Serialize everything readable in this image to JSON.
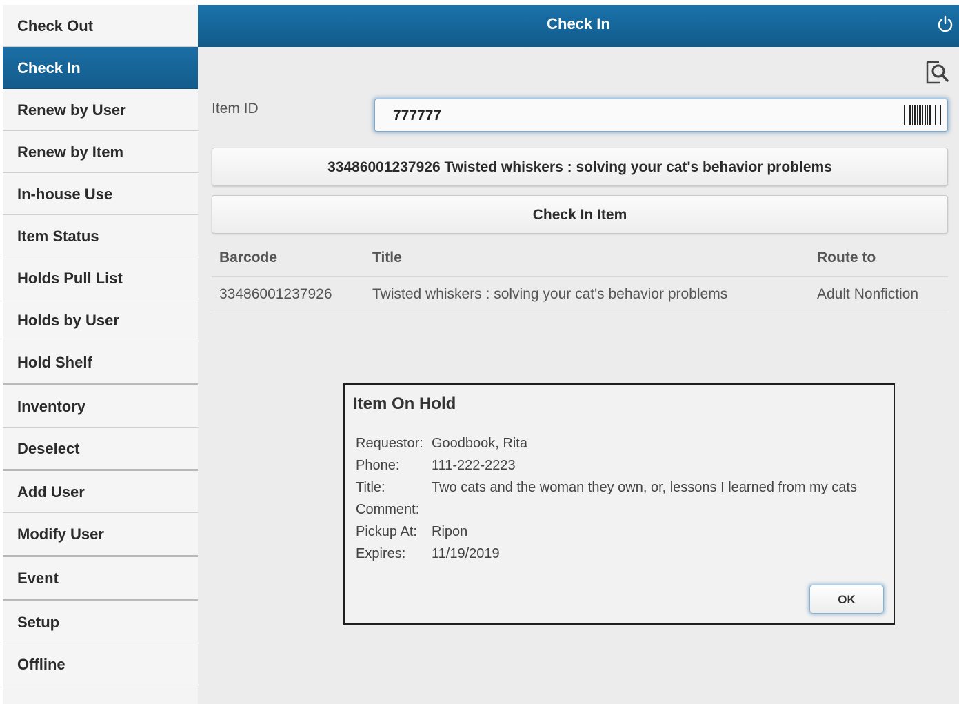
{
  "sidebar": {
    "items": [
      {
        "label": "Check Out"
      },
      {
        "label": "Check In"
      },
      {
        "label": "Renew by User"
      },
      {
        "label": "Renew by Item"
      },
      {
        "label": "In-house Use"
      },
      {
        "label": "Item Status"
      },
      {
        "label": "Holds Pull List"
      },
      {
        "label": "Holds by User"
      },
      {
        "label": "Hold Shelf"
      },
      {
        "label": "Inventory"
      },
      {
        "label": "Deselect"
      },
      {
        "label": "Add User"
      },
      {
        "label": "Modify User"
      },
      {
        "label": "Event"
      },
      {
        "label": "Setup"
      },
      {
        "label": "Offline"
      }
    ],
    "active": "Check In"
  },
  "header": {
    "title": "Check In",
    "power_icon": "power-icon"
  },
  "main": {
    "search_icon": "search-document-icon",
    "item_id_label": "Item ID",
    "item_id_value": "777777",
    "barcode_icon": "barcode-icon",
    "item_button_label": "33486001237926 Twisted whiskers : solving your cat's behavior problems",
    "checkin_button_label": "Check In Item",
    "table": {
      "headers": [
        "Barcode",
        "Title",
        "Route to"
      ],
      "rows": [
        {
          "barcode": "33486001237926",
          "title": "Twisted whiskers : solving your cat's behavior problems",
          "route": "Adult Nonfiction"
        }
      ]
    }
  },
  "dialog": {
    "title": "Item On Hold",
    "fields": [
      {
        "label": "Requestor:",
        "value": "Goodbook, Rita"
      },
      {
        "label": "Phone:",
        "value": "111-222-2223"
      },
      {
        "label": "Title:",
        "value": "Two cats and the woman they own, or, lessons I learned from my cats"
      },
      {
        "label": "Comment:",
        "value": ""
      },
      {
        "label": "Pickup At:",
        "value": "Ripon"
      },
      {
        "label": "Expires:",
        "value": "11/19/2019"
      }
    ],
    "ok_label": "OK"
  },
  "colors": {
    "accent": "#1a6ea5",
    "sidebar_bg": "#f5f5f5",
    "main_bg": "#ececec"
  }
}
